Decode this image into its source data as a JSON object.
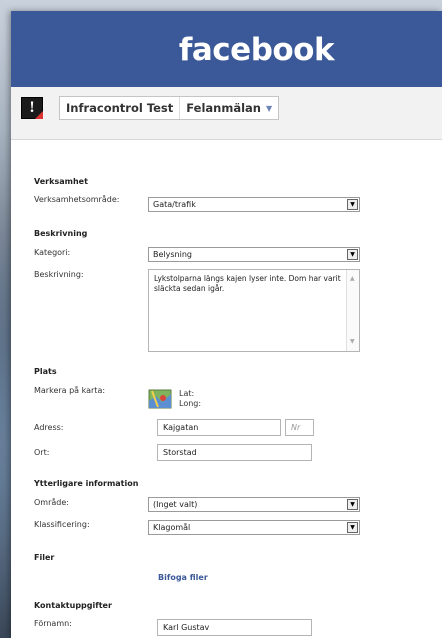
{
  "header": {
    "logo": "facebook"
  },
  "appbar": {
    "crumbs": [
      {
        "label": "Infracontrol Test"
      },
      {
        "label": "Felanmälan",
        "caret": "▼"
      }
    ]
  },
  "form": {
    "verksamhet": {
      "title": "Verksamhet",
      "area_label": "Verksamhetsområde:",
      "area_value": "Gata/trafik"
    },
    "beskrivning": {
      "title": "Beskrivning",
      "kategori_label": "Kategori:",
      "kategori_value": "Belysning",
      "beskrivning_label": "Beskrivning:",
      "beskrivning_value": "Lykstolparna längs kajen lyser inte. Dom har varit släckta sedan igår."
    },
    "plats": {
      "title": "Plats",
      "map_label": "Markera på karta:",
      "lat_label": "Lat:",
      "long_label": "Long:",
      "adress_label": "Adress:",
      "adress_value": "Kajgatan",
      "nr_placeholder": "Nr",
      "ort_label": "Ort:",
      "ort_value": "Storstad"
    },
    "ytterligare": {
      "title": "Ytterligare information",
      "omrade_label": "Område:",
      "omrade_value": "(Inget valt)",
      "klass_label": "Klassificering:",
      "klass_value": "Klagomål"
    },
    "filer": {
      "title": "Filer",
      "link": "Bifoga filer"
    },
    "kontakt": {
      "title": "Kontaktuppgifter",
      "fornamn_label": "Förnamn:",
      "fornamn_value": "Karl Gustav"
    }
  },
  "colors": {
    "brand": "#3b5998",
    "link": "#3b5998"
  }
}
